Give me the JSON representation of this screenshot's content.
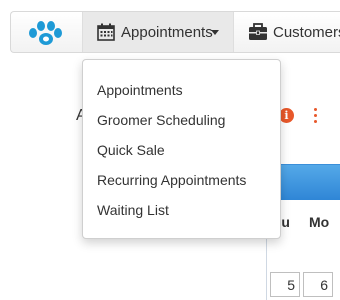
{
  "nav": {
    "logo": "paw-logo",
    "appointments": {
      "label": "Appointments",
      "icon": "calendar-icon"
    },
    "customers": {
      "label": "Customers",
      "icon": "briefcase-icon"
    }
  },
  "dropdown": {
    "items": [
      {
        "label": "Appointments"
      },
      {
        "label": "Groomer Scheduling"
      },
      {
        "label": "Quick Sale"
      },
      {
        "label": "Recurring Appointments"
      },
      {
        "label": "Waiting List"
      }
    ]
  },
  "page": {
    "heading_fragment": "A",
    "info_icon": "i",
    "calendar": {
      "days_of_week": [
        "Su",
        "Mo"
      ],
      "dates": [
        "5",
        "6"
      ]
    }
  },
  "colors": {
    "accent_orange": "#e8582a",
    "logo_blue": "#1e9ad6",
    "calendar_blue": "#3b8fd9"
  }
}
